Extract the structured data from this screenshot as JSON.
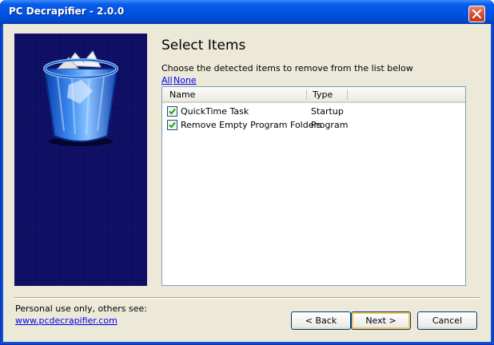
{
  "window": {
    "title": "PC Decrapifier - 2.0.0"
  },
  "icons": {
    "close": "close-icon",
    "banner": "recycle-bin-icon",
    "checkbox": "checkmark-icon"
  },
  "content": {
    "heading": "Select Items",
    "instructions": "Choose the detected items to remove from the list below",
    "select_all_label": "All",
    "select_none_label": "None"
  },
  "list": {
    "columns": [
      "Name",
      "Type"
    ],
    "rows": [
      {
        "name": "QuickTime Task",
        "type": "Startup",
        "checked": true
      },
      {
        "name": "Remove Empty Program Folders",
        "type": "Program",
        "checked": true
      }
    ]
  },
  "footer": {
    "note": "Personal use only, others see:",
    "link": "www.pcdecrapifier.com"
  },
  "buttons": {
    "back": "< Back",
    "next": "Next >",
    "cancel": "Cancel"
  },
  "colors": {
    "titlebar": "#0053e4",
    "panel": "#ece9d8",
    "banner": "#0a0a5a",
    "link": "#0000ee",
    "checkmark": "#21a121"
  }
}
